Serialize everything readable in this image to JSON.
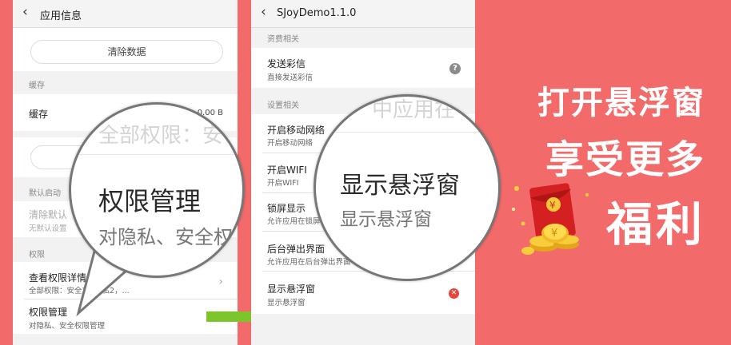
{
  "colors": {
    "background": "#f36a6a",
    "arrow": "#7cc62c",
    "close_icon": "#e8453c",
    "help_icon": "#8b8b8b"
  },
  "screen1": {
    "title": "应用信息",
    "clear_data_button": "清除数据",
    "cache_section": "缓存",
    "cache_label": "缓存",
    "cache_size": "0.00 B",
    "default_launch_section": "默认启动",
    "clear_defaults_title": "清除默认",
    "clear_defaults_sub": "无默认设置",
    "permissions_section": "权限",
    "view_permissions_title": "查看权限详情",
    "view_permissions_sub": "全部权限：安全2，隐私2，...",
    "manage_permissions_title": "权限管理",
    "manage_permissions_sub": "对隐私、安全权限管理",
    "magnifier": {
      "ghost_text": "全部权限：安",
      "title": "权限管理",
      "subtitle": "对隐私、安全权"
    }
  },
  "screen2": {
    "title": "SJoyDemo1.1.0",
    "charge_section": "资费相关",
    "items_charge": [
      {
        "title": "发送彩信",
        "sub": "直接发送彩信",
        "icon": "help-icon"
      }
    ],
    "settings_section": "设置相关",
    "items": [
      {
        "title": "开启移动网络",
        "sub": "开启移动网络"
      },
      {
        "title": "开启WIFI",
        "sub": "开启WIFI"
      },
      {
        "title": "锁屏显示",
        "sub": "允许应用在锁屏上显示"
      },
      {
        "title": "后台弹出界面",
        "sub": "允许应用在后台弹出界面"
      },
      {
        "title": "显示悬浮窗",
        "sub": "显示悬浮窗",
        "icon": "close-icon"
      }
    ],
    "magnifier": {
      "ghost_text": "中应用在",
      "title": "显示悬浮窗",
      "subtitle": "显示悬浮窗"
    }
  },
  "promo": {
    "line1": "打开悬浮窗",
    "line2": "享受更多",
    "line3": "福利"
  },
  "icons": [
    "back-arrow-icon",
    "chevron-right-icon",
    "help-icon",
    "close-icon",
    "arrow-right-icon",
    "red-envelope-icon",
    "gold-coins-icon"
  ]
}
